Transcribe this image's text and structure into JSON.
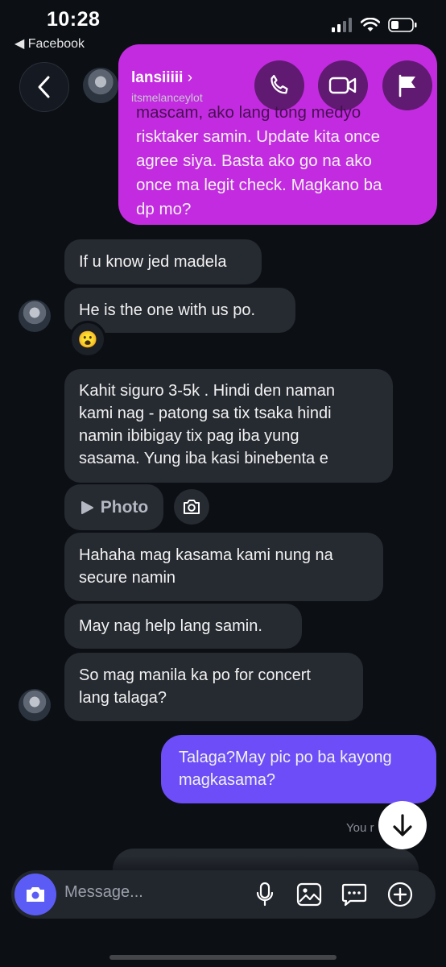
{
  "status": {
    "time": "10:28",
    "back_app": "◀ Facebook"
  },
  "header": {
    "name": "lansiiiii",
    "handle": "itsmelanceylot"
  },
  "messages": {
    "m1": {
      "lines": [
        "mascam, ako lang tong medyo",
        "risktaker samin. Update kita once",
        "agree siya. Basta ako go na ako",
        "once ma legit check. Magkano ba",
        "dp mo?"
      ]
    },
    "m2": "If u know jed madela",
    "m3": "He is the one with us po.",
    "m3_reaction": "😮",
    "m4": {
      "lines": [
        "Kahit siguro 3-5k . Hindi den naman",
        "kami nag - patong sa tix tsaka hindi",
        "namin ibibigay tix pag iba yung",
        "sasama. Yung iba kasi binebenta e"
      ]
    },
    "photo_label": "Photo",
    "m5": {
      "lines": [
        "Hahaha mag kasama kami nung na",
        "secure namin"
      ]
    },
    "m6": "May nag help lang samin.",
    "m7": {
      "lines": [
        "So mag manila ka po for concert",
        "lang talaga?"
      ]
    },
    "m8": {
      "lines": [
        "Talaga?May pic po ba kayong",
        "magkasama?"
      ]
    },
    "seen_label": "You r"
  },
  "composer": {
    "placeholder": "Message..."
  },
  "colors": {
    "outgoing": "#6c4df7",
    "outgoing_magenta": "#c32be0",
    "incoming": "#262a31",
    "accent": "#5b5cf6"
  }
}
